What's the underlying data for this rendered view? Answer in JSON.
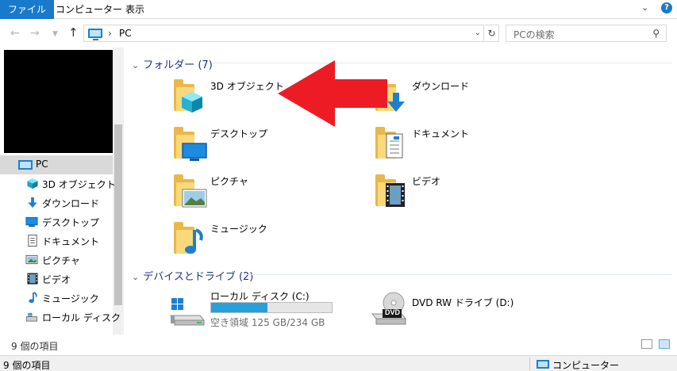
{
  "ribbon": {
    "tabs": [
      {
        "label": "ファイル",
        "active": true
      },
      {
        "label": "コンピューター",
        "active": false
      },
      {
        "label": "表示",
        "active": false
      }
    ]
  },
  "address": {
    "path": "PC",
    "refresh_icon": "refresh-icon",
    "search_placeholder": "PCの検索"
  },
  "nav": {
    "root": "PC",
    "items": [
      {
        "label": "3D オブジェクト",
        "icon": "cube-icon"
      },
      {
        "label": "ダウンロード",
        "icon": "download-arrow-icon"
      },
      {
        "label": "デスクトップ",
        "icon": "desktop-icon"
      },
      {
        "label": "ドキュメント",
        "icon": "document-icon"
      },
      {
        "label": "ピクチャ",
        "icon": "picture-icon"
      },
      {
        "label": "ビデオ",
        "icon": "film-icon"
      },
      {
        "label": "ミュージック",
        "icon": "music-note-icon"
      },
      {
        "label": "ローカル ディスク (C",
        "icon": "drive-icon"
      }
    ]
  },
  "folders": {
    "header": "フォルダー (7)",
    "items": [
      {
        "label": "3D オブジェクト",
        "overlay": "cube-icon"
      },
      {
        "label": "ダウンロード",
        "overlay": "download-arrow-icon"
      },
      {
        "label": "デスクトップ",
        "overlay": "desktop-icon"
      },
      {
        "label": "ドキュメント",
        "overlay": "document-icon"
      },
      {
        "label": "ピクチャ",
        "overlay": "picture-icon"
      },
      {
        "label": "ビデオ",
        "overlay": "film-icon"
      },
      {
        "label": "ミュージック",
        "overlay": "music-note-icon"
      }
    ]
  },
  "devices": {
    "header": "デバイスとドライブ (2)",
    "drives": [
      {
        "name": "ローカル ディスク (C:)",
        "space": "空き領域 125 GB/234 GB",
        "used_fraction": 0.466,
        "icon": "windows-drive-icon"
      },
      {
        "name": "DVD RW ドライブ (D:)",
        "icon": "dvd-drive-icon",
        "disc_label": "DVD"
      }
    ]
  },
  "status": {
    "item_count": "9 個の項目",
    "bottom_count": "9 個の項目",
    "location": "コンピューター"
  },
  "colors": {
    "accent": "#1979ca",
    "arrow": "#ed1c24",
    "folder": "#f9d97a",
    "drive_fill": "#26a0da",
    "group_header": "#1e3287"
  }
}
